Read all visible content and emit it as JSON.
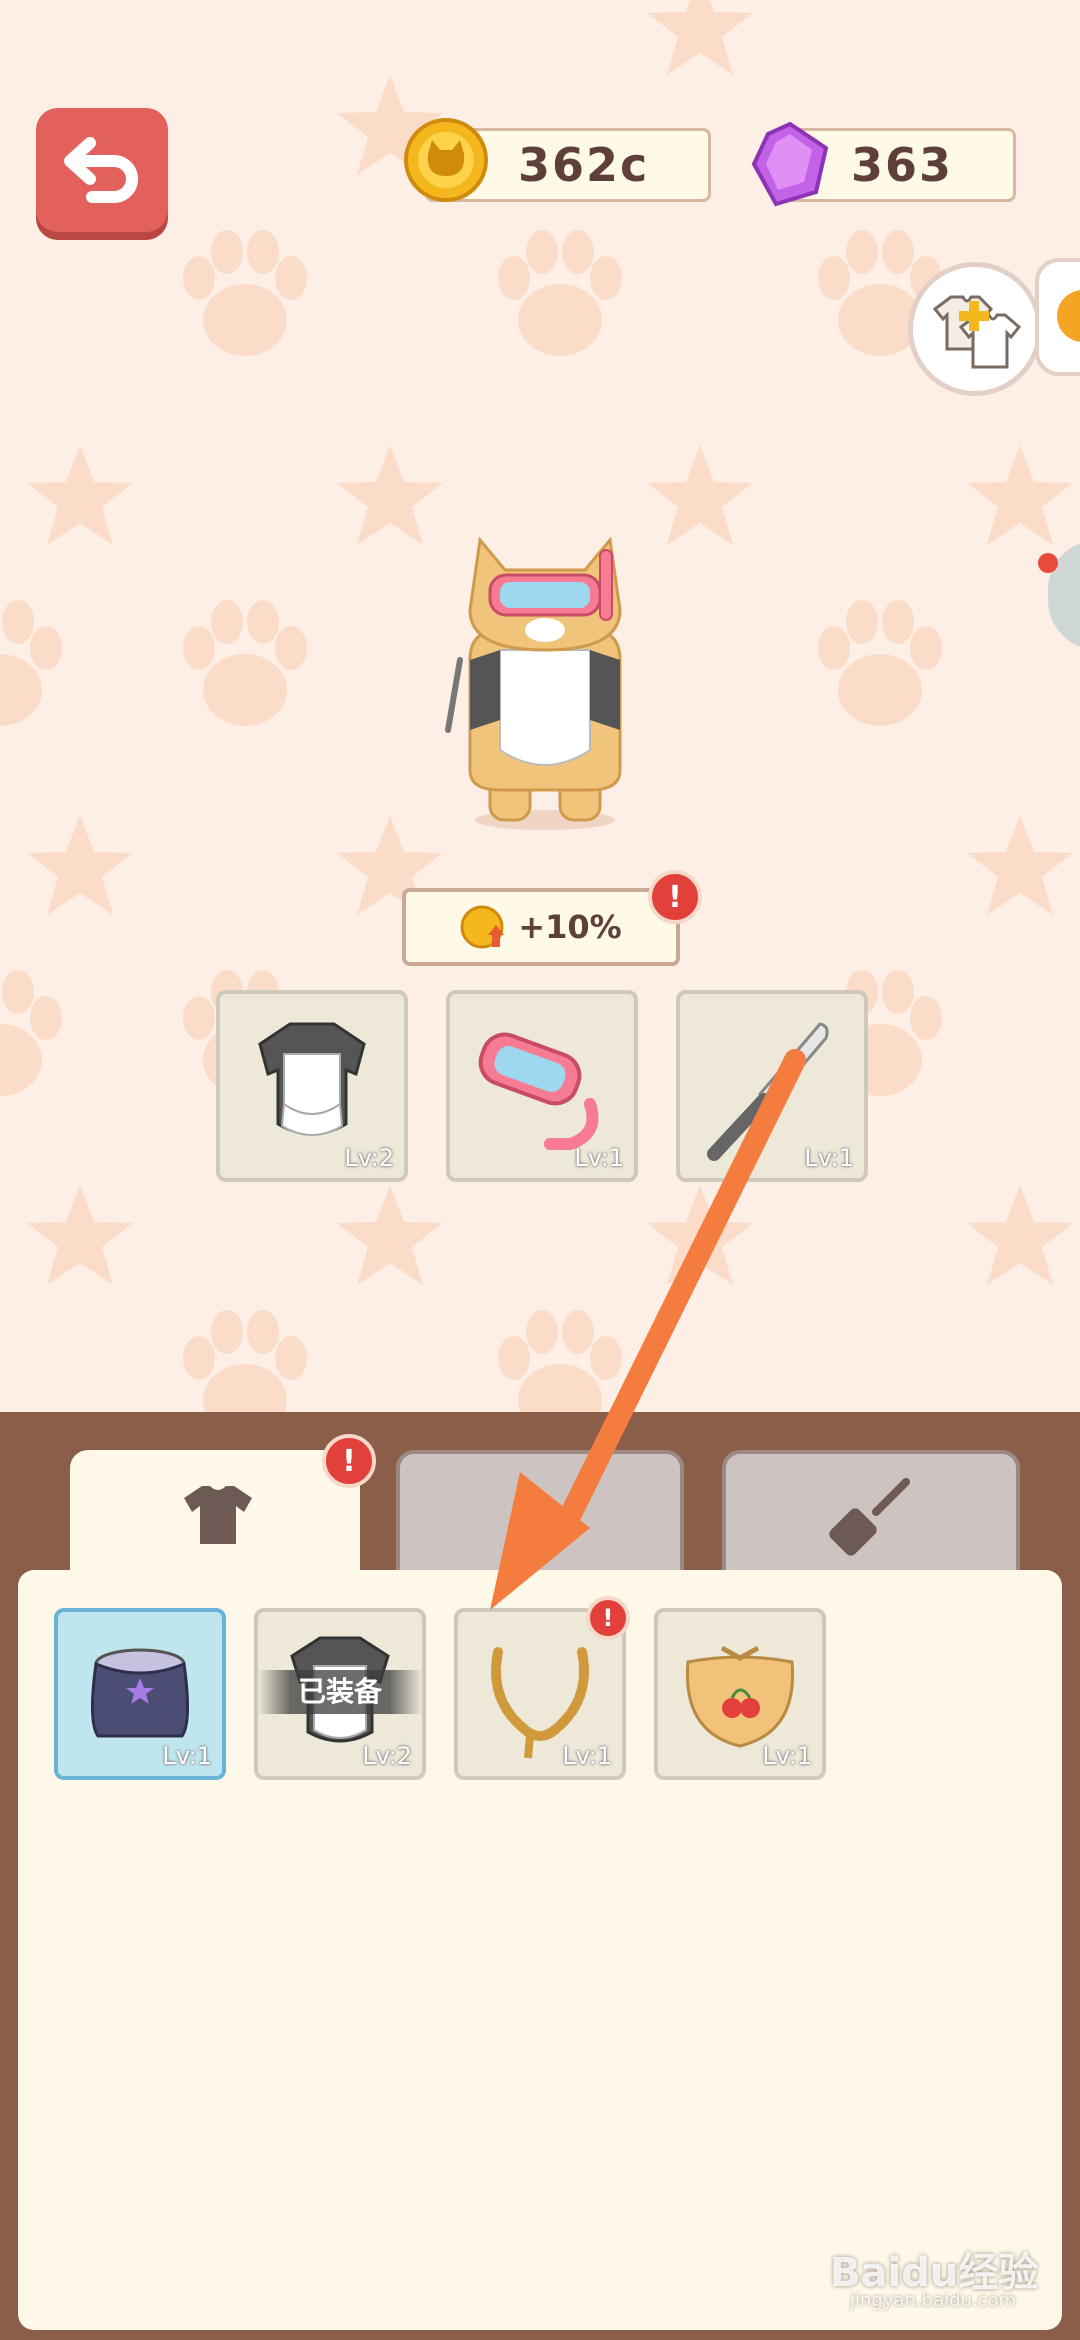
{
  "header": {
    "coins": "362c",
    "gems": "363"
  },
  "character": {
    "bonus": "+10%"
  },
  "equipped": [
    {
      "name": "maid-dress",
      "level": "Lv:2"
    },
    {
      "name": "snorkel-goggles",
      "level": "Lv:1"
    },
    {
      "name": "knife",
      "level": "Lv:1"
    }
  ],
  "tabs": [
    {
      "name": "clothes",
      "icon": "shirt-icon"
    },
    {
      "name": "headwear",
      "icon": "hat-icon"
    },
    {
      "name": "tools",
      "icon": "spatula-icon"
    }
  ],
  "inventory": [
    {
      "name": "purple-skirt",
      "level": "Lv:1",
      "selected": true
    },
    {
      "name": "maid-dress",
      "level": "Lv:2",
      "status": "已装备"
    },
    {
      "name": "necklace",
      "level": "Lv:1"
    },
    {
      "name": "cherry-bib",
      "level": "Lv:1"
    }
  ],
  "watermark": {
    "brand": "Baidu经验",
    "url": "jingyan.baidu.com"
  },
  "colors": {
    "background": "#fdeee6",
    "panel": "#8a5e49",
    "accent_red": "#e2615c",
    "arrow": "#f57c3f"
  }
}
